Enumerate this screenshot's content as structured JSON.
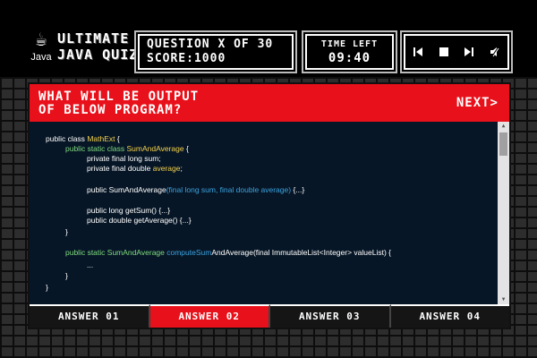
{
  "logo": {
    "text": "Java"
  },
  "title": {
    "line1": "ULTIMATE",
    "line2": "JAVA QUIZ"
  },
  "status": {
    "question": "QUESTION X OF 30",
    "score": "SCORE:1000"
  },
  "timer": {
    "label": "TIME LEFT",
    "value": "09:40"
  },
  "controls": [
    "previous-icon",
    "stop-icon",
    "next-track-icon",
    "mute-icon"
  ],
  "question": {
    "line1": "WHAT WILL BE OUTPUT",
    "line2": "OF BELOW PROGRAM?"
  },
  "next_label": "NEXT>",
  "code": [
    "public class MathExt {",
    "public static class SumAndAverage {",
    "private final long sum;",
    "private final double average;",
    "public SumAndAverage(final long sum, final double average) {...}",
    "public long getSum() {...}",
    "public double getAverage() {...}",
    "}",
    "public static SumAndAverage computeSumAndAverage(final ImmutableList<Integer> valueList) {",
    "...",
    "}",
    "}"
  ],
  "answers": [
    {
      "label": "ANSWER 01",
      "selected": false
    },
    {
      "label": "ANSWER 02",
      "selected": true
    },
    {
      "label": "ANSWER 03",
      "selected": false
    },
    {
      "label": "ANSWER 04",
      "selected": false
    }
  ],
  "colors": {
    "accent": "#e8101a",
    "board": "#071626",
    "keyword": "#f4d34c",
    "type": "#7fdc7f",
    "param": "#3aa3e0"
  }
}
